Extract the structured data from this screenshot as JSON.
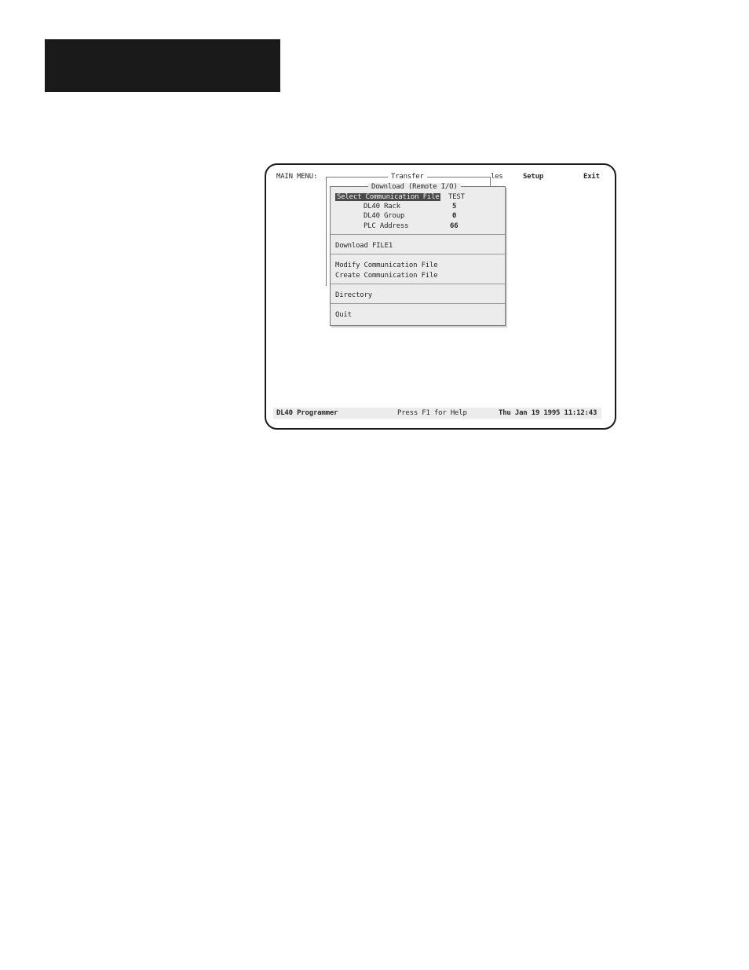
{
  "menu_bar": {
    "main_menu": "MAIN MENU:",
    "files_partial": "les",
    "setup": "Setup",
    "exit": "Exit"
  },
  "transfer_window": {
    "title": "Transfer"
  },
  "download_dialog": {
    "title": "Download (Remote I/O)",
    "select_comm_file_label": "Select Communication File",
    "select_comm_file_value": "TEST",
    "rack_label": "DL40 Rack",
    "rack_value": "5",
    "group_label": "DL40 Group",
    "group_value": "0",
    "plc_address_label": "PLC Address",
    "plc_address_value": "66",
    "download_file": "Download FILE1",
    "modify_comm_file": "Modify Communication File",
    "create_comm_file": "Create Communication File",
    "directory": "Directory",
    "quit": "Quit"
  },
  "status_bar": {
    "app_name": "DL40 Programmer",
    "help_hint": "Press F1 for Help",
    "datetime": "Thu Jan 19 1995 11:12:43"
  }
}
